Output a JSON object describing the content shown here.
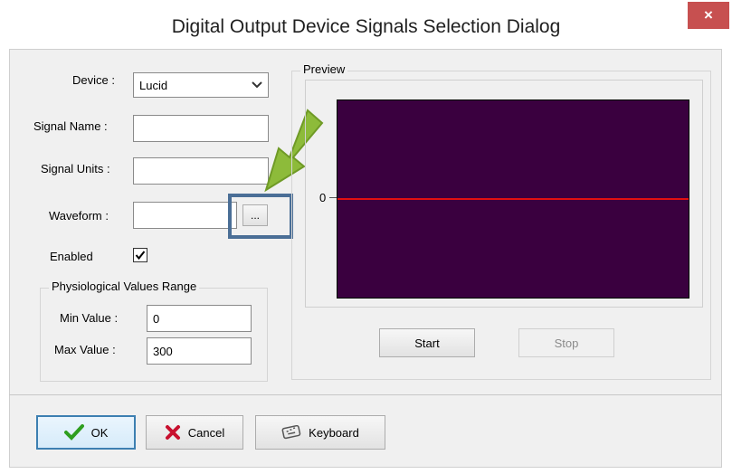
{
  "window": {
    "title": "Digital Output Device Signals Selection Dialog",
    "close_glyph": "×"
  },
  "form": {
    "device_label": "Device :",
    "device_value": "Lucid",
    "signal_name_label": "Signal Name :",
    "signal_name_value": "",
    "signal_units_label": "Signal Units :",
    "signal_units_value": "",
    "waveform_label": "Waveform :",
    "waveform_value": "",
    "waveform_browse_label": "...",
    "enabled_label": "Enabled",
    "enabled_checked": true
  },
  "range_group": {
    "title": "Physiological Values Range",
    "min_label": "Min Value :",
    "min_value": "0",
    "max_label": "Max Value :",
    "max_value": "300"
  },
  "preview": {
    "title": "Preview",
    "axis_label": "0",
    "background_color": "#3a003f",
    "line_color": "#e01010",
    "start_label": "Start",
    "stop_label": "Stop"
  },
  "footer": {
    "ok_label": "OK",
    "cancel_label": "Cancel",
    "keyboard_label": "Keyboard"
  },
  "annotation": {
    "arrow_color": "#8dbb3a",
    "highlight_color": "#4a6e96"
  }
}
